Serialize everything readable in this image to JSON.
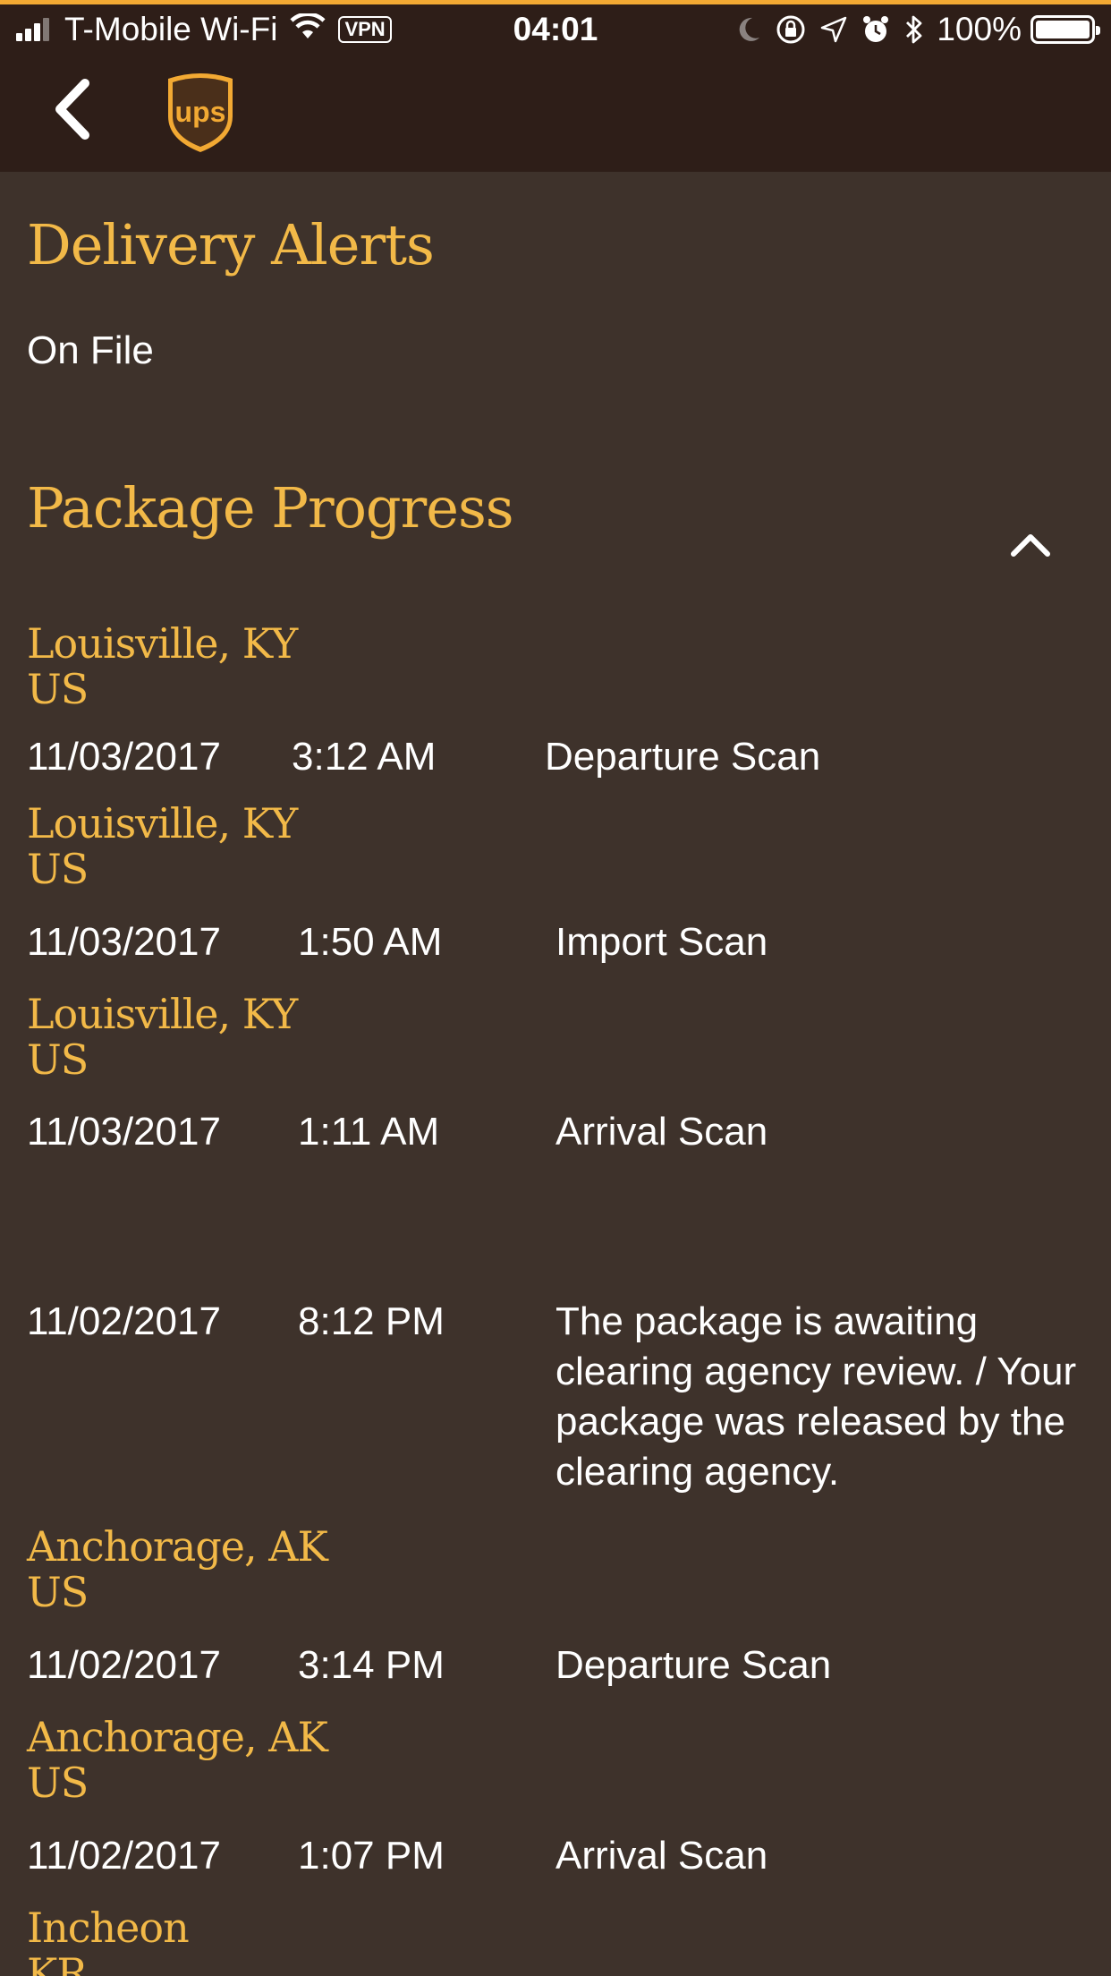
{
  "status_bar": {
    "carrier": "T-Mobile Wi-Fi",
    "vpn": "VPN",
    "time": "04:01",
    "battery": "100%"
  },
  "nav": {
    "logo_text": "ups"
  },
  "delivery_alerts": {
    "title": "Delivery Alerts",
    "value": "On File"
  },
  "package_progress": {
    "title": "Package Progress",
    "events": [
      {
        "city": "Louisville, KY",
        "country": "US",
        "date": "11/03/2017",
        "time": "3:12 AM",
        "desc": "Departure Scan"
      },
      {
        "city": "Louisville, KY",
        "country": "US",
        "date": "11/03/2017",
        "time": "1:50 AM",
        "desc": "Import Scan"
      },
      {
        "city": "Louisville, KY",
        "country": "US",
        "date": "11/03/2017",
        "time": "1:11 AM",
        "desc": "Arrival Scan"
      },
      {
        "city": "",
        "country": "",
        "date": "11/02/2017",
        "time": "8:12 PM",
        "desc": "The package is awaiting clearing agency review. / Your package was released by the clearing agency."
      },
      {
        "city": "Anchorage, AK",
        "country": "US",
        "date": "11/02/2017",
        "time": "3:14 PM",
        "desc": "Departure Scan"
      },
      {
        "city": "Anchorage, AK",
        "country": "US",
        "date": "11/02/2017",
        "time": "1:07 PM",
        "desc": "Arrival Scan"
      },
      {
        "city": "Incheon",
        "country": "KR",
        "date": "",
        "time": "",
        "desc": ""
      }
    ]
  },
  "colors": {
    "accent": "#f2b948",
    "background": "#3e322b",
    "header": "#2e1e18"
  }
}
